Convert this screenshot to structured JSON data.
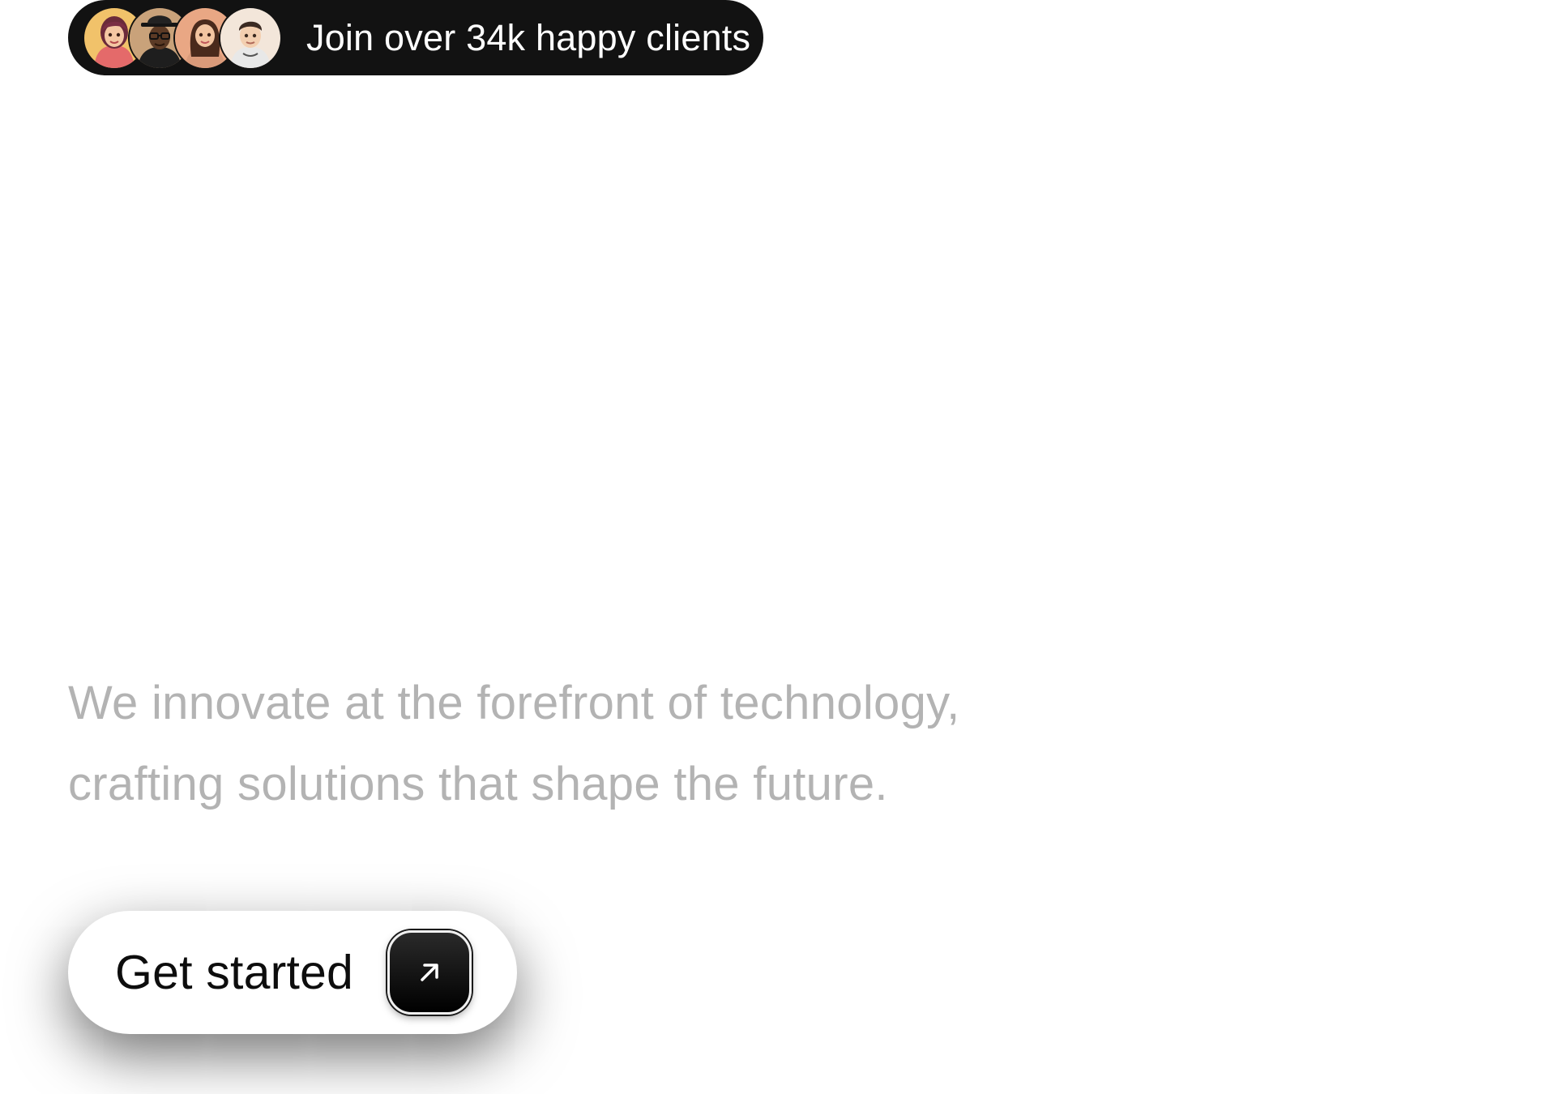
{
  "social_proof": {
    "text": "Join over 34k happy clients",
    "avatars": [
      {
        "icon": "avatar-woman-purple-hair-icon",
        "bg": "#f1c26a"
      },
      {
        "icon": "avatar-man-hat-glasses-icon",
        "bg": "#c9a27a"
      },
      {
        "icon": "avatar-woman-long-hair-icon",
        "bg": "#e9a784"
      },
      {
        "icon": "avatar-man-short-hair-icon",
        "bg": "#f3e6da"
      }
    ]
  },
  "hero": {
    "tagline_line1": "We innovate at the forefront of technology,",
    "tagline_line2": "crafting solutions that shape the future."
  },
  "cta": {
    "label": "Get started",
    "icon": "arrow-up-right-icon"
  },
  "colors": {
    "pill_bg": "#121212",
    "tagline": "#b3b3b3",
    "page_bg": "#ffffff",
    "cta_text": "#0d0d0d"
  }
}
